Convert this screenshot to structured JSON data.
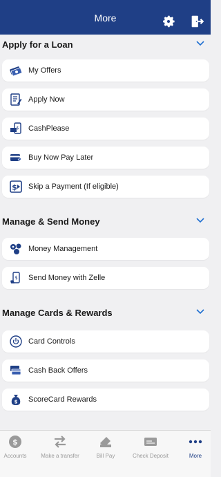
{
  "header": {
    "title": "More"
  },
  "sections": [
    {
      "title": "Apply for a Loan",
      "items": [
        {
          "label": "My Offers",
          "icon": "money-icon"
        },
        {
          "label": "Apply Now",
          "icon": "document-icon"
        },
        {
          "label": "CashPlease",
          "icon": "cash-phone-icon"
        },
        {
          "label": "Buy Now Pay Later",
          "icon": "card-icon"
        },
        {
          "label": "Skip a Payment (If eligible)",
          "icon": "skip-payment-icon"
        }
      ]
    },
    {
      "title": "Manage & Send Money",
      "items": [
        {
          "label": "Money Management",
          "icon": "coins-icon"
        },
        {
          "label": "Send Money with Zelle",
          "icon": "zelle-icon"
        }
      ]
    },
    {
      "title": "Manage Cards & Rewards",
      "items": [
        {
          "label": "Card Controls",
          "icon": "power-icon"
        },
        {
          "label": "Cash Back Offers",
          "icon": "cards-icon"
        },
        {
          "label": "ScoreCard Rewards",
          "icon": "moneybag-icon"
        }
      ]
    }
  ],
  "tabs": [
    {
      "label": "Accounts",
      "icon": "dollar-icon"
    },
    {
      "label": "Make a transfer",
      "icon": "transfer-icon"
    },
    {
      "label": "Bill Pay",
      "icon": "bill-pay-icon"
    },
    {
      "label": "Check Deposit",
      "icon": "check-icon"
    },
    {
      "label": "More",
      "icon": "more-icon",
      "active": true
    }
  ],
  "colors": {
    "brand": "#1f3f86",
    "icon": "#1f3f86",
    "background": "#f0f0f2"
  }
}
